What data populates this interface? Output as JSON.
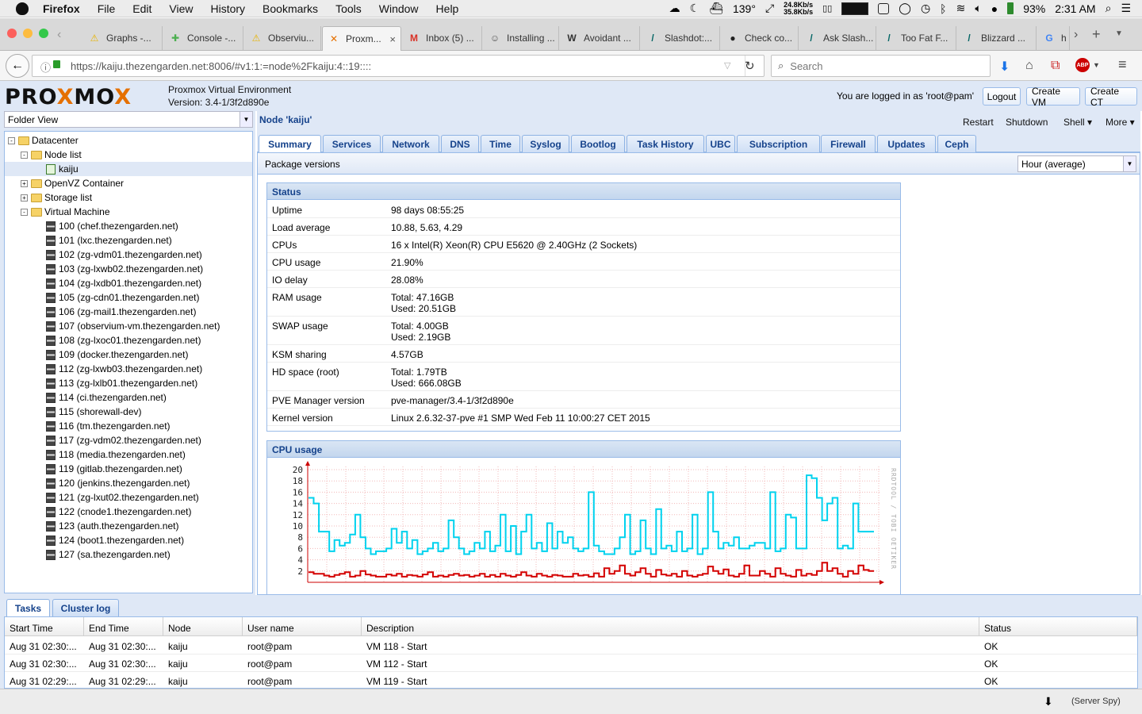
{
  "menubar": {
    "app": "Firefox",
    "items": [
      "File",
      "Edit",
      "View",
      "History",
      "Bookmarks",
      "Tools",
      "Window",
      "Help"
    ],
    "temp": "139°",
    "net_up": "24.8Kb/s",
    "net_down": "35.8Kb/s",
    "battery": "93%",
    "clock": "2:31 AM"
  },
  "tabs": [
    {
      "title": "Graphs -...",
      "icon": "warning-icon",
      "color": "#e8b400"
    },
    {
      "title": "Console -...",
      "icon": "puzzle-icon",
      "color": "#4caf50"
    },
    {
      "title": "Observiu...",
      "icon": "warning-icon",
      "color": "#e8b400"
    },
    {
      "title": "Proxm...",
      "icon": "proxmox-icon",
      "color": "#e57000",
      "active": true
    },
    {
      "title": "Inbox (5) ...",
      "icon": "gmail-icon",
      "color": "#d93025"
    },
    {
      "title": "Installing ...",
      "icon": "robot-icon",
      "color": "#555"
    },
    {
      "title": "Avoidant ...",
      "icon": "wikipedia-icon",
      "color": "#333"
    },
    {
      "title": "Slashdot:...",
      "icon": "slashdot-icon",
      "color": "#046665"
    },
    {
      "title": "Check co...",
      "icon": "github-icon",
      "color": "#222"
    },
    {
      "title": "Ask Slash...",
      "icon": "slashdot-icon",
      "color": "#046665"
    },
    {
      "title": "Too Fat F...",
      "icon": "slashdot-icon",
      "color": "#046665"
    },
    {
      "title": "Blizzard ...",
      "icon": "slashdot-icon",
      "color": "#046665"
    },
    {
      "title": "h",
      "icon": "google-icon",
      "color": "#4285f4"
    }
  ],
  "navbar": {
    "url": "https://kaiju.thezengarden.net:8006/#v1:1:=node%2Fkaiju:4::19::::",
    "search_placeholder": "Search"
  },
  "pve": {
    "product": "Proxmox Virtual Environment",
    "version": "Version: 3.4-1/3f2d890e",
    "logged_in": "You are logged in as 'root@pam'",
    "logout": "Logout",
    "create_vm": "Create VM",
    "create_ct": "Create CT"
  },
  "tree": {
    "view": "Folder View",
    "nodes": [
      {
        "label": "Datacenter",
        "level": 0,
        "type": "folder",
        "exp": "-"
      },
      {
        "label": "Node list",
        "level": 1,
        "type": "folder",
        "exp": "-"
      },
      {
        "label": "kaiju",
        "level": 2,
        "type": "node",
        "selected": true
      },
      {
        "label": "OpenVZ Container",
        "level": 1,
        "type": "folder",
        "exp": "+"
      },
      {
        "label": "Storage list",
        "level": 1,
        "type": "folder",
        "exp": "+"
      },
      {
        "label": "Virtual Machine",
        "level": 1,
        "type": "folder",
        "exp": "-"
      },
      {
        "label": "100 (chef.thezengarden.net)",
        "level": 2,
        "type": "vm"
      },
      {
        "label": "101 (lxc.thezengarden.net)",
        "level": 2,
        "type": "vm"
      },
      {
        "label": "102 (zg-vdm01.thezengarden.net)",
        "level": 2,
        "type": "vm"
      },
      {
        "label": "103 (zg-lxwb02.thezengarden.net)",
        "level": 2,
        "type": "vm"
      },
      {
        "label": "104 (zg-lxdb01.thezengarden.net)",
        "level": 2,
        "type": "vm"
      },
      {
        "label": "105 (zg-cdn01.thezengarden.net)",
        "level": 2,
        "type": "vm"
      },
      {
        "label": "106 (zg-mail1.thezengarden.net)",
        "level": 2,
        "type": "vm"
      },
      {
        "label": "107 (observium-vm.thezengarden.net)",
        "level": 2,
        "type": "vm"
      },
      {
        "label": "108 (zg-lxoc01.thezengarden.net)",
        "level": 2,
        "type": "vm"
      },
      {
        "label": "109 (docker.thezengarden.net)",
        "level": 2,
        "type": "vm"
      },
      {
        "label": "112 (zg-lxwb03.thezengarden.net)",
        "level": 2,
        "type": "vm"
      },
      {
        "label": "113 (zg-lxlb01.thezengarden.net)",
        "level": 2,
        "type": "vm"
      },
      {
        "label": "114 (ci.thezengarden.net)",
        "level": 2,
        "type": "vm"
      },
      {
        "label": "115 (shorewall-dev)",
        "level": 2,
        "type": "vm"
      },
      {
        "label": "116 (tm.thezengarden.net)",
        "level": 2,
        "type": "vm"
      },
      {
        "label": "117 (zg-vdm02.thezengarden.net)",
        "level": 2,
        "type": "vm"
      },
      {
        "label": "118 (media.thezengarden.net)",
        "level": 2,
        "type": "vm"
      },
      {
        "label": "119 (gitlab.thezengarden.net)",
        "level": 2,
        "type": "vm"
      },
      {
        "label": "120 (jenkins.thezengarden.net)",
        "level": 2,
        "type": "vm"
      },
      {
        "label": "121 (zg-lxut02.thezengarden.net)",
        "level": 2,
        "type": "vm"
      },
      {
        "label": "122 (cnode1.thezengarden.net)",
        "level": 2,
        "type": "vm"
      },
      {
        "label": "123 (auth.thezengarden.net)",
        "level": 2,
        "type": "vm"
      },
      {
        "label": "124 (boot1.thezengarden.net)",
        "level": 2,
        "type": "vm"
      },
      {
        "label": "127 (sa.thezengarden.net)",
        "level": 2,
        "type": "vm"
      }
    ]
  },
  "node": {
    "title": "Node 'kaiju'",
    "actions": [
      "Restart",
      "Shutdown",
      "Shell ▾",
      "More ▾"
    ],
    "tabs": [
      "Summary",
      "Services",
      "Network",
      "DNS",
      "Time",
      "Syslog",
      "Bootlog",
      "Task History",
      "UBC",
      "Subscription",
      "Firewall",
      "Updates",
      "Ceph"
    ],
    "active_tab": "Summary",
    "package_versions": "Package versions",
    "timeframe": "Hour (average)"
  },
  "status": {
    "title": "Status",
    "rows": [
      {
        "key": "Uptime",
        "value": "98 days 08:55:25"
      },
      {
        "key": "Load average",
        "value": "10.88, 5.63, 4.29"
      },
      {
        "key": "CPUs",
        "value": "16 x Intel(R) Xeon(R) CPU E5620 @ 2.40GHz (2 Sockets)"
      },
      {
        "key": "CPU usage",
        "value": "21.90%"
      },
      {
        "key": "IO delay",
        "value": "28.08%"
      },
      {
        "key": "RAM usage",
        "value": "Total: 47.16GB",
        "value2": "Used: 20.51GB"
      },
      {
        "key": "SWAP usage",
        "value": "Total: 4.00GB",
        "value2": "Used: 2.19GB"
      },
      {
        "key": "KSM sharing",
        "value": "4.57GB"
      },
      {
        "key": "HD space (root)",
        "value": "Total: 1.79TB",
        "value2": "Used: 666.08GB"
      },
      {
        "key": "PVE Manager version",
        "value": "pve-manager/3.4-1/3f2d890e"
      },
      {
        "key": "Kernel version",
        "value": "Linux 2.6.32-37-pve #1 SMP Wed Feb 11 10:00:27 CET 2015"
      }
    ]
  },
  "cpu_panel_title": "CPU usage",
  "chart_data": {
    "type": "line",
    "title": "",
    "ylim": [
      0,
      20
    ],
    "yticks": [
      2,
      4,
      6,
      8,
      10,
      12,
      14,
      16,
      18,
      20
    ],
    "watermark": "RRDTOOL / TOBI OETIKER",
    "series": [
      {
        "color": "#00d2ee",
        "values": [
          15,
          14,
          9,
          9,
          5.5,
          7.5,
          6.5,
          7,
          8.5,
          12,
          8,
          6,
          5,
          5.5,
          5.5,
          6,
          9.5,
          7,
          9,
          6,
          7.5,
          5,
          5.5,
          6,
          7,
          5.5,
          6,
          11,
          8,
          6,
          5,
          5.5,
          7,
          6,
          9,
          5.5,
          6.5,
          12,
          5.5,
          10,
          5,
          9,
          12,
          6,
          7,
          5.5,
          10.5,
          6,
          9,
          7,
          8,
          6,
          5.5,
          6,
          16,
          6.5,
          5.5,
          5,
          5,
          6,
          8,
          12,
          5,
          5.5,
          11,
          6,
          5,
          13,
          6,
          6.5,
          5.5,
          9,
          5.5,
          6,
          12,
          5,
          6,
          16,
          9,
          6,
          7,
          6.5,
          8,
          6,
          6,
          6.5,
          7,
          7,
          6,
          16,
          5.5,
          6,
          12,
          11.5,
          6,
          6,
          19,
          18.5,
          15,
          11,
          14,
          15,
          6,
          6.5,
          6,
          14,
          9,
          9,
          9
        ]
      },
      {
        "color": "#d40000",
        "values": [
          1.8,
          1.5,
          1.5,
          1.2,
          1,
          1.3,
          1.5,
          1.8,
          1,
          1.2,
          2,
          1.4,
          1.2,
          1,
          1,
          1.4,
          1.2,
          1.5,
          1,
          1.3,
          1.2,
          1,
          1.4,
          1.8,
          1,
          1.2,
          1,
          1.3,
          1.5,
          1.2,
          1.3,
          1,
          1.2,
          1.5,
          1,
          1.3,
          1,
          1.5,
          1.2,
          1,
          1.3,
          1.8,
          1.2,
          1,
          1.5,
          1.2,
          1,
          1.3,
          1.2,
          1,
          1,
          1.5,
          1.2,
          1.3,
          1,
          1.6,
          1,
          2.5,
          1.5,
          2,
          3,
          1.5,
          1.2,
          1.8,
          2.5,
          1.5,
          1,
          2.2,
          1.4,
          1.2,
          1.5,
          1,
          2,
          1.2,
          1,
          1.3,
          1.5,
          2.8,
          2,
          1.5,
          2.3,
          1.2,
          1,
          1.5,
          3,
          1.2,
          1.2,
          2,
          1.5,
          1,
          2.5,
          1.5,
          1.2,
          1,
          2.2,
          1.2,
          1.5,
          1.3,
          2,
          3.5,
          2,
          2.5,
          1.5,
          1,
          2,
          1.5,
          3,
          2.2,
          2
        ]
      }
    ]
  },
  "bottom": {
    "tabs": [
      "Tasks",
      "Cluster log"
    ],
    "columns": [
      "Start Time",
      "End Time",
      "Node",
      "User name",
      "Description",
      "Status"
    ],
    "rows": [
      [
        "Aug 31 02:30:...",
        "Aug 31 02:30:...",
        "kaiju",
        "root@pam",
        "VM 118 - Start",
        "OK"
      ],
      [
        "Aug 31 02:30:...",
        "Aug 31 02:30:...",
        "kaiju",
        "root@pam",
        "VM 112 - Start",
        "OK"
      ],
      [
        "Aug 31 02:29:...",
        "Aug 31 02:29:...",
        "kaiju",
        "root@pam",
        "VM 119 - Start",
        "OK"
      ]
    ]
  },
  "statusbar": {
    "server_spy": "(Server Spy)"
  }
}
